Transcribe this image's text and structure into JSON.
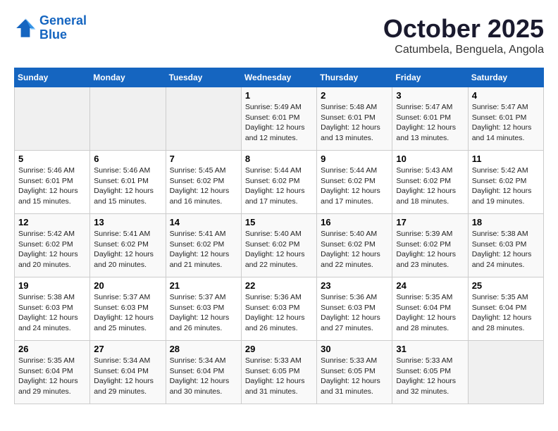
{
  "logo": {
    "line1": "General",
    "line2": "Blue"
  },
  "title": "October 2025",
  "subtitle": "Catumbela, Benguela, Angola",
  "days_of_week": [
    "Sunday",
    "Monday",
    "Tuesday",
    "Wednesday",
    "Thursday",
    "Friday",
    "Saturday"
  ],
  "weeks": [
    {
      "days": [
        {
          "num": "",
          "info": ""
        },
        {
          "num": "",
          "info": ""
        },
        {
          "num": "",
          "info": ""
        },
        {
          "num": "1",
          "info": "Sunrise: 5:49 AM\nSunset: 6:01 PM\nDaylight: 12 hours\nand 12 minutes."
        },
        {
          "num": "2",
          "info": "Sunrise: 5:48 AM\nSunset: 6:01 PM\nDaylight: 12 hours\nand 13 minutes."
        },
        {
          "num": "3",
          "info": "Sunrise: 5:47 AM\nSunset: 6:01 PM\nDaylight: 12 hours\nand 13 minutes."
        },
        {
          "num": "4",
          "info": "Sunrise: 5:47 AM\nSunset: 6:01 PM\nDaylight: 12 hours\nand 14 minutes."
        }
      ]
    },
    {
      "days": [
        {
          "num": "5",
          "info": "Sunrise: 5:46 AM\nSunset: 6:01 PM\nDaylight: 12 hours\nand 15 minutes."
        },
        {
          "num": "6",
          "info": "Sunrise: 5:46 AM\nSunset: 6:01 PM\nDaylight: 12 hours\nand 15 minutes."
        },
        {
          "num": "7",
          "info": "Sunrise: 5:45 AM\nSunset: 6:02 PM\nDaylight: 12 hours\nand 16 minutes."
        },
        {
          "num": "8",
          "info": "Sunrise: 5:44 AM\nSunset: 6:02 PM\nDaylight: 12 hours\nand 17 minutes."
        },
        {
          "num": "9",
          "info": "Sunrise: 5:44 AM\nSunset: 6:02 PM\nDaylight: 12 hours\nand 17 minutes."
        },
        {
          "num": "10",
          "info": "Sunrise: 5:43 AM\nSunset: 6:02 PM\nDaylight: 12 hours\nand 18 minutes."
        },
        {
          "num": "11",
          "info": "Sunrise: 5:42 AM\nSunset: 6:02 PM\nDaylight: 12 hours\nand 19 minutes."
        }
      ]
    },
    {
      "days": [
        {
          "num": "12",
          "info": "Sunrise: 5:42 AM\nSunset: 6:02 PM\nDaylight: 12 hours\nand 20 minutes."
        },
        {
          "num": "13",
          "info": "Sunrise: 5:41 AM\nSunset: 6:02 PM\nDaylight: 12 hours\nand 20 minutes."
        },
        {
          "num": "14",
          "info": "Sunrise: 5:41 AM\nSunset: 6:02 PM\nDaylight: 12 hours\nand 21 minutes."
        },
        {
          "num": "15",
          "info": "Sunrise: 5:40 AM\nSunset: 6:02 PM\nDaylight: 12 hours\nand 22 minutes."
        },
        {
          "num": "16",
          "info": "Sunrise: 5:40 AM\nSunset: 6:02 PM\nDaylight: 12 hours\nand 22 minutes."
        },
        {
          "num": "17",
          "info": "Sunrise: 5:39 AM\nSunset: 6:02 PM\nDaylight: 12 hours\nand 23 minutes."
        },
        {
          "num": "18",
          "info": "Sunrise: 5:38 AM\nSunset: 6:03 PM\nDaylight: 12 hours\nand 24 minutes."
        }
      ]
    },
    {
      "days": [
        {
          "num": "19",
          "info": "Sunrise: 5:38 AM\nSunset: 6:03 PM\nDaylight: 12 hours\nand 24 minutes."
        },
        {
          "num": "20",
          "info": "Sunrise: 5:37 AM\nSunset: 6:03 PM\nDaylight: 12 hours\nand 25 minutes."
        },
        {
          "num": "21",
          "info": "Sunrise: 5:37 AM\nSunset: 6:03 PM\nDaylight: 12 hours\nand 26 minutes."
        },
        {
          "num": "22",
          "info": "Sunrise: 5:36 AM\nSunset: 6:03 PM\nDaylight: 12 hours\nand 26 minutes."
        },
        {
          "num": "23",
          "info": "Sunrise: 5:36 AM\nSunset: 6:03 PM\nDaylight: 12 hours\nand 27 minutes."
        },
        {
          "num": "24",
          "info": "Sunrise: 5:35 AM\nSunset: 6:04 PM\nDaylight: 12 hours\nand 28 minutes."
        },
        {
          "num": "25",
          "info": "Sunrise: 5:35 AM\nSunset: 6:04 PM\nDaylight: 12 hours\nand 28 minutes."
        }
      ]
    },
    {
      "days": [
        {
          "num": "26",
          "info": "Sunrise: 5:35 AM\nSunset: 6:04 PM\nDaylight: 12 hours\nand 29 minutes."
        },
        {
          "num": "27",
          "info": "Sunrise: 5:34 AM\nSunset: 6:04 PM\nDaylight: 12 hours\nand 29 minutes."
        },
        {
          "num": "28",
          "info": "Sunrise: 5:34 AM\nSunset: 6:04 PM\nDaylight: 12 hours\nand 30 minutes."
        },
        {
          "num": "29",
          "info": "Sunrise: 5:33 AM\nSunset: 6:05 PM\nDaylight: 12 hours\nand 31 minutes."
        },
        {
          "num": "30",
          "info": "Sunrise: 5:33 AM\nSunset: 6:05 PM\nDaylight: 12 hours\nand 31 minutes."
        },
        {
          "num": "31",
          "info": "Sunrise: 5:33 AM\nSunset: 6:05 PM\nDaylight: 12 hours\nand 32 minutes."
        },
        {
          "num": "",
          "info": ""
        }
      ]
    }
  ]
}
